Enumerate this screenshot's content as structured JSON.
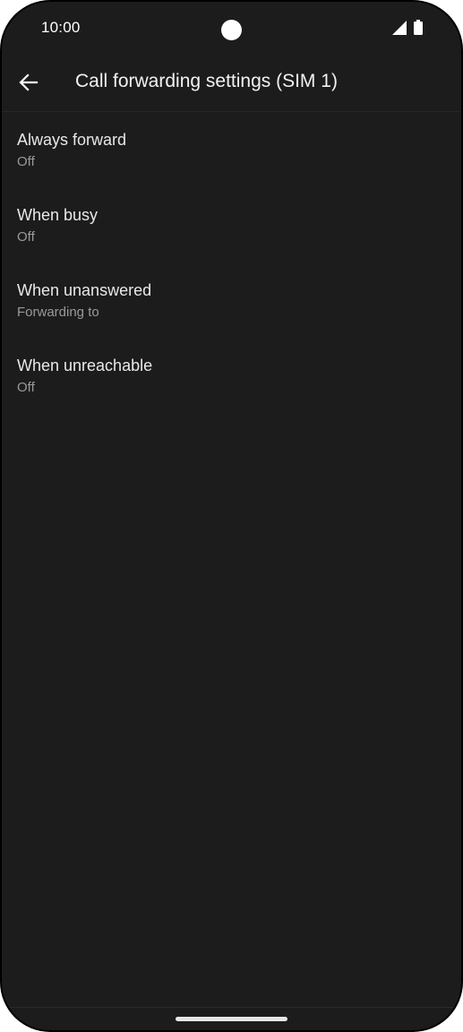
{
  "status_bar": {
    "time": "10:00",
    "icons": [
      "camera-cutout",
      "cellular-signal-icon",
      "battery-icon"
    ]
  },
  "app_bar": {
    "back_icon": "arrow-back-icon",
    "title": "Call forwarding settings (SIM 1)"
  },
  "settings": {
    "items": [
      {
        "title": "Always forward",
        "summary": "Off"
      },
      {
        "title": "When busy",
        "summary": "Off"
      },
      {
        "title": "When unanswered",
        "summary": "Forwarding to"
      },
      {
        "title": "When unreachable",
        "summary": "Off"
      }
    ]
  },
  "colors": {
    "background": "#1c1c1c",
    "primary_text": "#e8e8e8",
    "secondary_text": "#9a9a9a"
  }
}
